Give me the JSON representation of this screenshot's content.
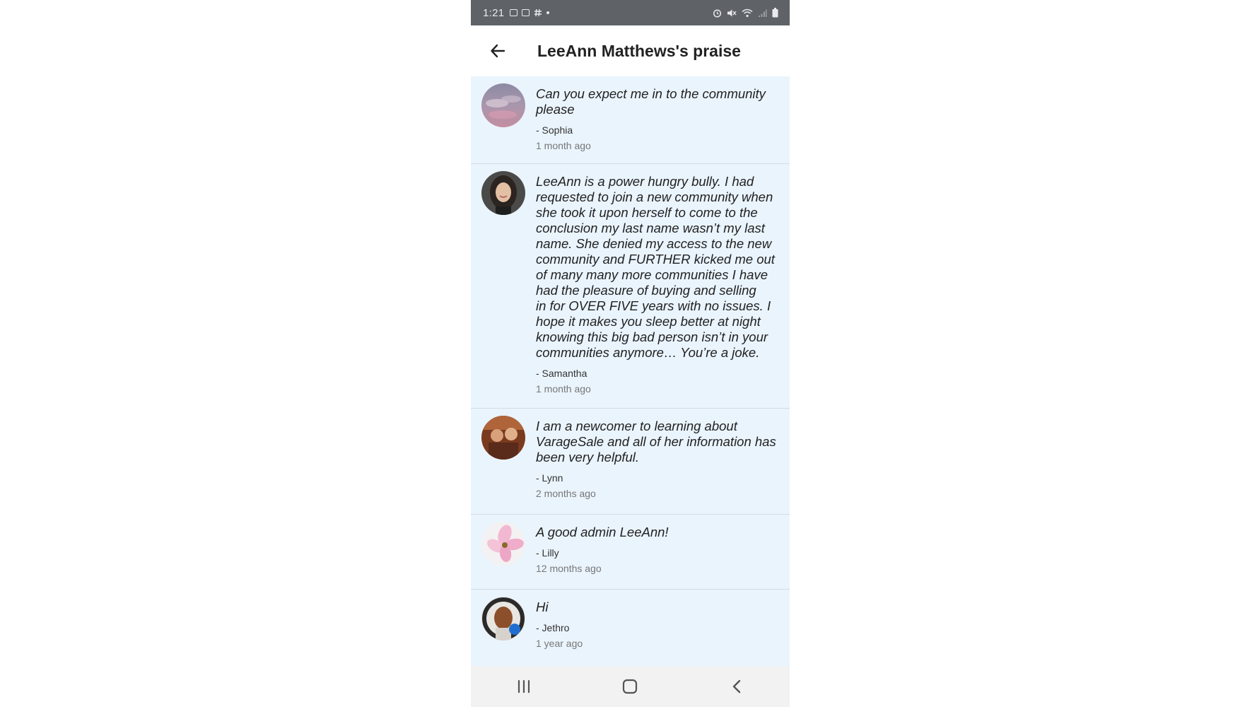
{
  "status_bar": {
    "time": "1:21",
    "left_icons": [
      "image-icon",
      "gallery-icon",
      "hashtag-icon",
      "dot-icon"
    ],
    "right_icons": [
      "alarm-icon",
      "mute-icon",
      "wifi-icon",
      "signal-icon",
      "battery-icon"
    ]
  },
  "header": {
    "title": "LeeAnn Matthews's praise",
    "back_icon": "arrow-left-icon"
  },
  "praise": [
    {
      "quote": "Can you expect me in to the community\nplease",
      "author": "- Sophia",
      "time": "1 month ago"
    },
    {
      "quote": "LeeAnn is a power hungry bully. I had\nrequested to join a new community when\nshe took it upon herself to come to the\nconclusion my last name wasn’t my last\nname. She denied my access to the new\ncommunity and FURTHER kicked me out\nof many many more communities I have\nhad the pleasure of buying and selling\nin for OVER FIVE years with no issues. I\nhope it makes you sleep better at night\nknowing this big bad person isn’t in your\ncommunities anymore… You’re a joke.",
      "author": "- Samantha",
      "time": "1 month ago"
    },
    {
      "quote": "I am a newcomer to learning about\nVarageSale and all of her information has\nbeen very helpful.",
      "author": "- Lynn",
      "time": "2 months ago"
    },
    {
      "quote": "A good admin LeeAnn!",
      "author": "- Lilly",
      "time": "12 months ago"
    },
    {
      "quote": "Hi",
      "author": "- Jethro",
      "time": "1 year ago"
    }
  ],
  "nav_bar": {
    "icons": [
      "recent-apps-icon",
      "home-icon",
      "back-icon"
    ]
  },
  "colors": {
    "status_bar": "#5f6368",
    "list_background": "#eaf4fd",
    "divider": "#d3dce4",
    "nav_bar": "#f2f2f2"
  }
}
